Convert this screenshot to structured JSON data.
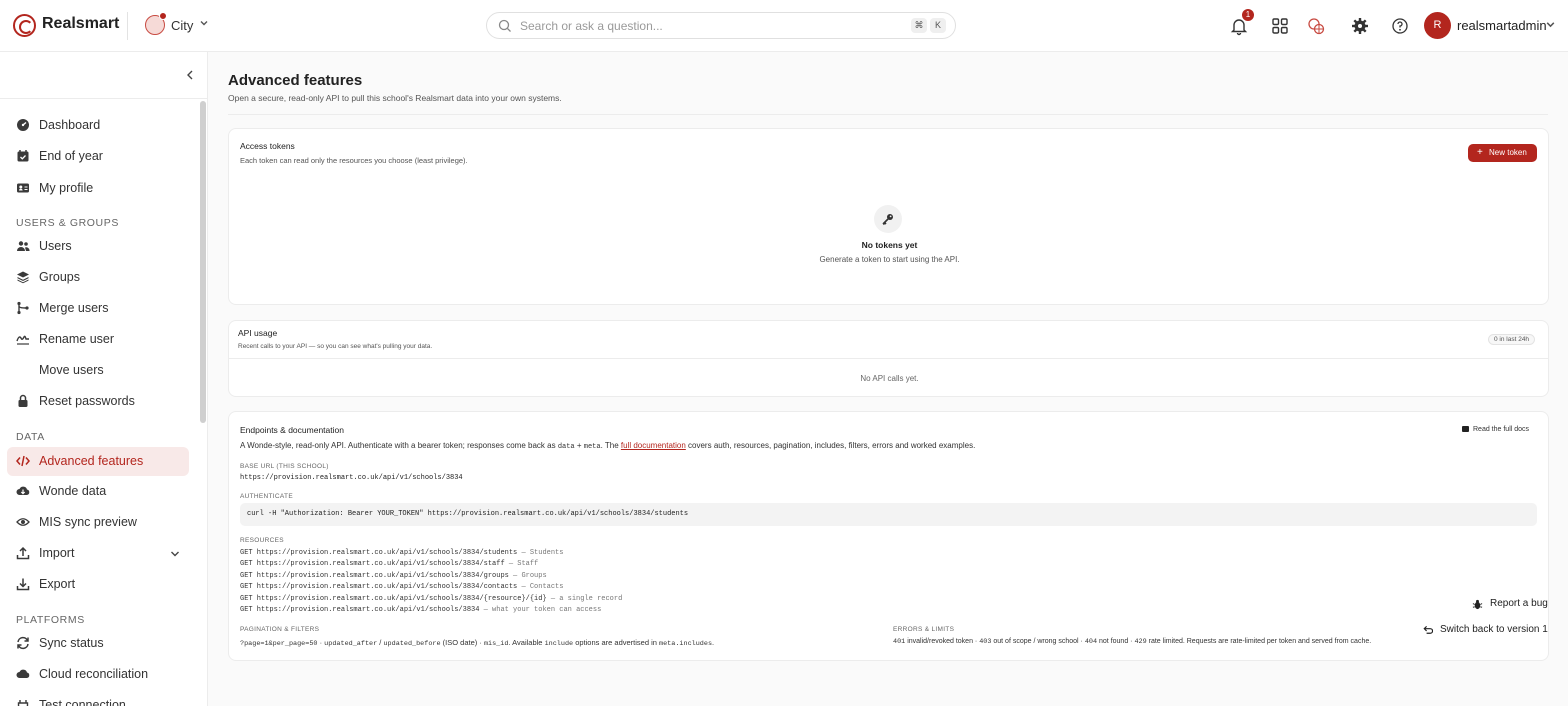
{
  "app": {
    "brand": "Realsmart"
  },
  "topbar": {
    "school": "City",
    "search_placeholder": "Search or ask a question...",
    "kbd_cmd": "⌘",
    "kbd_k": "K",
    "notification_count": "1",
    "avatar_initial": "R",
    "username": "realsmartadmin"
  },
  "sidebar": {
    "items_top": [
      {
        "label": "Dashboard",
        "icon": "gauge-icon"
      },
      {
        "label": "End of year",
        "icon": "calendar-check-icon"
      },
      {
        "label": "My profile",
        "icon": "id-card-icon"
      }
    ],
    "section_users": "USERS & GROUPS",
    "items_users": [
      {
        "label": "Users",
        "icon": "users-icon"
      },
      {
        "label": "Groups",
        "icon": "layers-icon"
      },
      {
        "label": "Merge users",
        "icon": "merge-icon"
      },
      {
        "label": "Rename user",
        "icon": "signature-icon"
      },
      {
        "label": "Move users"
      },
      {
        "label": "Reset passwords",
        "icon": "lock-icon"
      }
    ],
    "section_data": "DATA",
    "items_data": [
      {
        "label": "Advanced features",
        "icon": "code-icon",
        "active": true
      },
      {
        "label": "Wonde data",
        "icon": "cloud-download-icon"
      },
      {
        "label": "MIS sync preview",
        "icon": "eye-icon"
      },
      {
        "label": "Import",
        "icon": "upload-icon"
      },
      {
        "label": "Export",
        "icon": "download-icon"
      }
    ],
    "section_platforms": "PLATFORMS",
    "items_platforms": [
      {
        "label": "Sync status",
        "icon": "sync-icon"
      },
      {
        "label": "Cloud reconciliation",
        "icon": "cloud-icon"
      },
      {
        "label": "Test connection",
        "icon": "plug-icon"
      }
    ]
  },
  "page": {
    "title": "Advanced features",
    "subtitle": "Open a secure, read-only API to pull this school's Realsmart data into your own systems."
  },
  "tokens_card": {
    "title": "Access tokens",
    "subtitle": "Each token can read only the resources you choose (least privilege).",
    "new_token": "New token",
    "empty_title": "No tokens yet",
    "empty_sub": "Generate a token to start using the API."
  },
  "usage_card": {
    "title": "API usage",
    "subtitle": "Recent calls to your API — so you can see what's pulling your data.",
    "pill": "0 in last 24h",
    "empty": "No API calls yet."
  },
  "docs_card": {
    "title": "Endpoints & documentation",
    "read_docs": "Read the full docs",
    "intro_a": "A Wonde-style, read-only API. Authenticate with a bearer token; responses come back as ",
    "intro_code_data": "data",
    "intro_plus": " + ",
    "intro_code_meta": "meta",
    "intro_b": ". The ",
    "intro_link": "full documentation",
    "intro_c": " covers auth, resources, pagination, includes, filters, errors and worked examples.",
    "base_url_label": "BASE URL (THIS SCHOOL)",
    "base_url": "https://provision.realsmart.co.uk/api/v1/schools/3834",
    "auth_label": "AUTHENTICATE",
    "auth_cmd": "curl -H \"Authorization: Bearer YOUR_TOKEN\" https://provision.realsmart.co.uk/api/v1/schools/3834/students",
    "resources_label": "RESOURCES",
    "resources": [
      {
        "path": "GET https://provision.realsmart.co.uk/api/v1/schools/3834/students",
        "desc": " — Students"
      },
      {
        "path": "GET https://provision.realsmart.co.uk/api/v1/schools/3834/staff",
        "desc": " — Staff"
      },
      {
        "path": "GET https://provision.realsmart.co.uk/api/v1/schools/3834/groups",
        "desc": " — Groups"
      },
      {
        "path": "GET https://provision.realsmart.co.uk/api/v1/schools/3834/contacts",
        "desc": " — Contacts"
      },
      {
        "path": "GET https://provision.realsmart.co.uk/api/v1/schools/3834/{resource}/{id}",
        "desc": " — a single record"
      },
      {
        "path": "GET https://provision.realsmart.co.uk/api/v1/schools/3834",
        "desc": " — what your token can access"
      }
    ],
    "pagination_label": "PAGINATION & FILTERS",
    "pag_code1": "?page=1&per_page=50",
    "pag_t1": " · ",
    "pag_code2": "updated_after",
    "pag_t2": " / ",
    "pag_code3": "updated_before",
    "pag_t3": " (ISO date) · ",
    "pag_code4": "mis_id",
    "pag_t4": ". Available ",
    "pag_code5": "include",
    "pag_t5": " options are advertised in ",
    "pag_code6": "meta.includes",
    "pag_t6": ".",
    "errors_label": "ERRORS & LIMITS",
    "err_c1": "401",
    "err_t1": " invalid/revoked token · ",
    "err_c2": "403",
    "err_t2": " out of scope / wrong school · ",
    "err_c3": "404",
    "err_t3": " not found · ",
    "err_c4": "429",
    "err_t4": " rate limited. Requests are rate-limited per token and served from cache."
  },
  "floating": {
    "report_bug": "Report a bug",
    "switch_back": "Switch back to version 1"
  },
  "colors": {
    "accent": "#b3261e",
    "active_bg": "#f8e9e8"
  }
}
